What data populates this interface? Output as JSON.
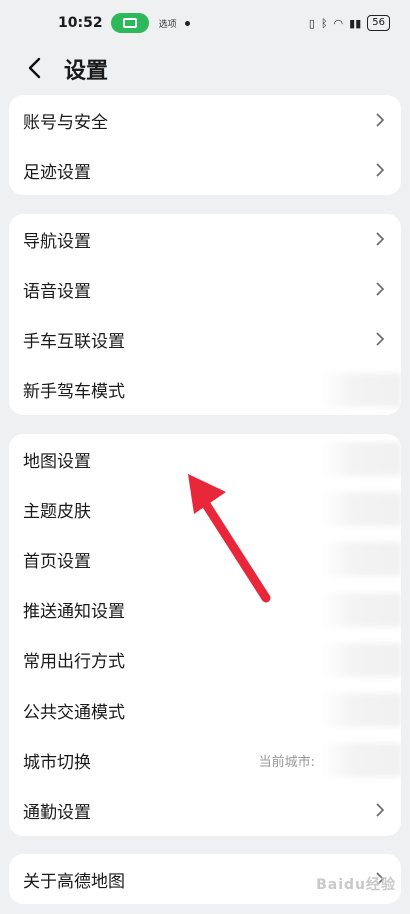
{
  "status_bar": {
    "time": "10:52",
    "small_text": "选项",
    "battery": "56"
  },
  "header": {
    "title": "设置"
  },
  "groups": [
    {
      "items": [
        {
          "label": "账号与安全"
        },
        {
          "label": "足迹设置"
        }
      ]
    },
    {
      "items": [
        {
          "label": "导航设置"
        },
        {
          "label": "语音设置"
        },
        {
          "label": "手车互联设置"
        },
        {
          "label": "新手驾车模式"
        }
      ]
    },
    {
      "items": [
        {
          "label": "地图设置"
        },
        {
          "label": "主题皮肤"
        },
        {
          "label": "首页设置"
        },
        {
          "label": "推送通知设置"
        },
        {
          "label": "常用出行方式"
        },
        {
          "label": "公共交通模式"
        },
        {
          "label": "城市切换",
          "value": "当前城市:"
        },
        {
          "label": "通勤设置"
        }
      ]
    },
    {
      "items": [
        {
          "label": "关于高德地图"
        }
      ]
    }
  ],
  "watermark": "Baidu经验",
  "colors": {
    "accent_arrow": "#e8283a",
    "cast_pill": "#2eb85c"
  }
}
